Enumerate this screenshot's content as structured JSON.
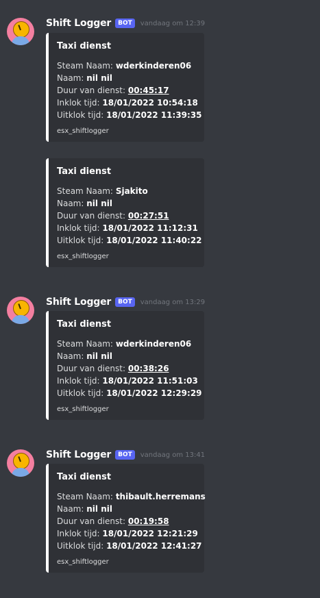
{
  "messages": [
    {
      "username": "Shift Logger",
      "bot_tag": "BOT",
      "timestamp": "vandaag om 12:39",
      "embeds": [
        {
          "title": "Taxi dienst",
          "steam_label": "Steam Naam:",
          "steam_name": "wderkinderen06",
          "name_label": "Naam:",
          "name": "nil nil",
          "duration_label": "Duur van dienst:",
          "duration": "00:45:17",
          "in_label": "Inklok tijd:",
          "in_time": "18/01/2022 10:54:18",
          "out_label": "Uitklok tijd:",
          "out_time": "18/01/2022 11:39:35",
          "footer": "esx_shiftlogger"
        },
        {
          "title": "Taxi dienst",
          "steam_label": "Steam Naam:",
          "steam_name": "Sjakito",
          "name_label": "Naam:",
          "name": "nil nil",
          "duration_label": "Duur van dienst:",
          "duration": "00:27:51",
          "in_label": "Inklok tijd:",
          "in_time": "18/01/2022 11:12:31",
          "out_label": "Uitklok tijd:",
          "out_time": "18/01/2022 11:40:22",
          "footer": "esx_shiftlogger"
        }
      ]
    },
    {
      "username": "Shift Logger",
      "bot_tag": "BOT",
      "timestamp": "vandaag om 13:29",
      "embeds": [
        {
          "title": "Taxi dienst",
          "steam_label": "Steam Naam:",
          "steam_name": "wderkinderen06",
          "name_label": "Naam:",
          "name": "nil nil",
          "duration_label": "Duur van dienst:",
          "duration": "00:38:26",
          "in_label": "Inklok tijd:",
          "in_time": "18/01/2022 11:51:03",
          "out_label": "Uitklok tijd:",
          "out_time": "18/01/2022 12:29:29",
          "footer": "esx_shiftlogger"
        }
      ]
    },
    {
      "username": "Shift Logger",
      "bot_tag": "BOT",
      "timestamp": "vandaag om 13:41",
      "embeds": [
        {
          "title": "Taxi dienst",
          "steam_label": "Steam Naam:",
          "steam_name": "thibault.herremans",
          "name_label": "Naam:",
          "name": "nil nil",
          "duration_label": "Duur van dienst:",
          "duration": "00:19:58",
          "in_label": "Inklok tijd:",
          "in_time": "18/01/2022 12:21:29",
          "out_label": "Uitklok tijd:",
          "out_time": "18/01/2022 12:41:27",
          "footer": "esx_shiftlogger"
        }
      ]
    }
  ]
}
